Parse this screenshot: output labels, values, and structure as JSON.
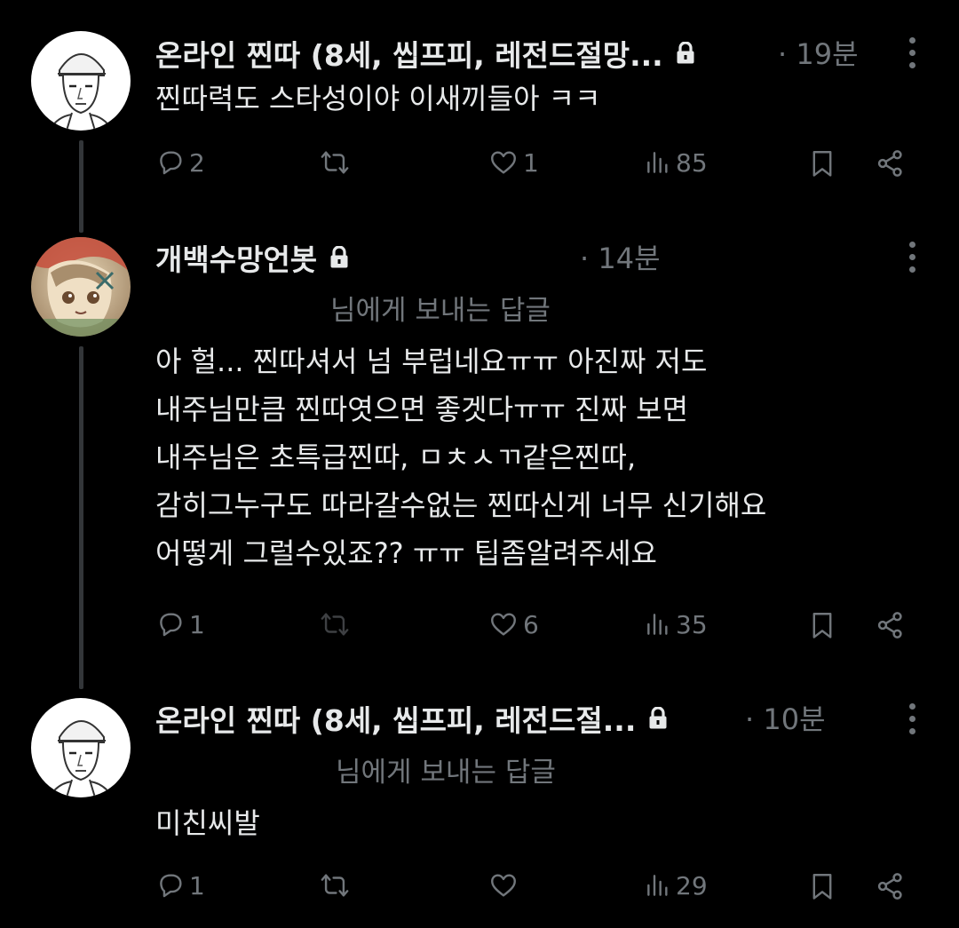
{
  "colors": {
    "background": "#000000",
    "text": "#e7e9ea",
    "muted": "#71767b",
    "thread_line": "#333639"
  },
  "posts": [
    {
      "author": "온라인 찐따 (8세, 씹프피, 레전드절망...",
      "locked": true,
      "time": "· 19분",
      "reply_to": "",
      "text": "찐따력도 스타성이야 이새끼들아 ㅋㅋ",
      "stats": {
        "replies": "2",
        "reposts": "",
        "likes": "1",
        "views": "85"
      }
    },
    {
      "author": "개백수망언봇",
      "locked": true,
      "time": "· 14분",
      "reply_to": "님에게 보내는 답글",
      "text": "아 헐... 찐따셔서 넘 부럽네요ㅠㅠ 아진짜 저도\n내주님만큼 찐따엿으면 좋겟다ㅠㅠ 진짜 보면\n내주님은 초특급찐따, ㅁㅊㅅㄲ같은찐따,\n감히그누구도 따라갈수없는 찐따신게 너무 신기해요\n어떻게 그럴수있죠?? ㅠㅠ 팁좀알려주세요",
      "stats": {
        "replies": "1",
        "reposts": "",
        "likes": "6",
        "views": "35"
      }
    },
    {
      "author": "온라인 찐따 (8세, 씹프피, 레전드절...",
      "locked": true,
      "time": "· 10분",
      "reply_to": "님에게 보내는 답글",
      "text": "미친씨발",
      "stats": {
        "replies": "1",
        "reposts": "",
        "likes": "",
        "views": "29"
      }
    }
  ],
  "icons": {
    "reply": "reply-icon",
    "repost": "repost-icon",
    "like": "heart-icon",
    "views": "views-icon",
    "bookmark": "bookmark-icon",
    "share": "share-icon",
    "lock": "lock-icon",
    "more": "more-icon"
  }
}
